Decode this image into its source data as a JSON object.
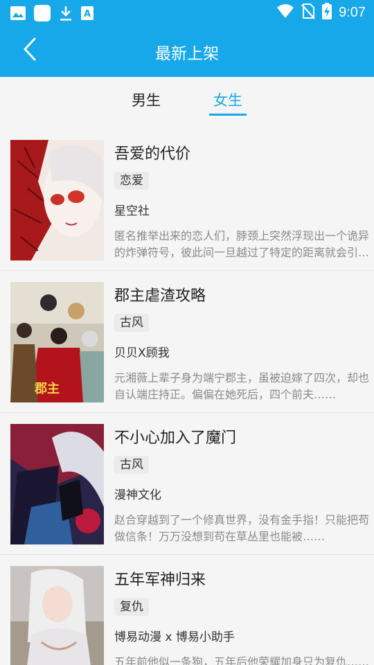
{
  "status_bar": {
    "time": "9:07",
    "icons": [
      "gallery-icon",
      "square-app-icon",
      "download-icon",
      "font-a-icon",
      "wifi-icon",
      "no-sim-icon",
      "battery-charging-icon"
    ]
  },
  "appbar": {
    "title": "最新上架",
    "back_icon": "chevron-left-icon"
  },
  "tabs": [
    {
      "label": "男生",
      "selected": false
    },
    {
      "label": "女生",
      "selected": true
    }
  ],
  "colors": {
    "accent": "#17a8ea",
    "background": "#f5f5f5",
    "tag_bg": "#ebebeb",
    "desc_text": "#8a8a8a"
  },
  "books": [
    {
      "title": "吾爱的代价",
      "tag": "恋爱",
      "author": "星空社",
      "description": "匿名推举出来的恋人们，脖颈上突然浮现出一个诡异的炸弹符号，彼此间一旦越过了特定的距离就会引爆……"
    },
    {
      "title": "郡主虐渣攻略",
      "tag": "古风",
      "author": "贝贝X顾我",
      "description": "元湘薇上辈子身为端宁郡主，虽被迫嫁了四次，却也自认端庄持正。偏偏在她死后，四个前夫……"
    },
    {
      "title": "不小心加入了魔门",
      "tag": "古风",
      "author": "漫神文化",
      "description": "赵合穿越到了一个修真世界，没有金手指！只能把苟做信条！万万没想到苟在草丛里也能被……"
    },
    {
      "title": "五年军神归来",
      "tag": "复仇",
      "author": "博易动漫 x 博易小助手",
      "description": "五年前他似一条狗，五年后他荣耀加身只为复仇……"
    }
  ]
}
